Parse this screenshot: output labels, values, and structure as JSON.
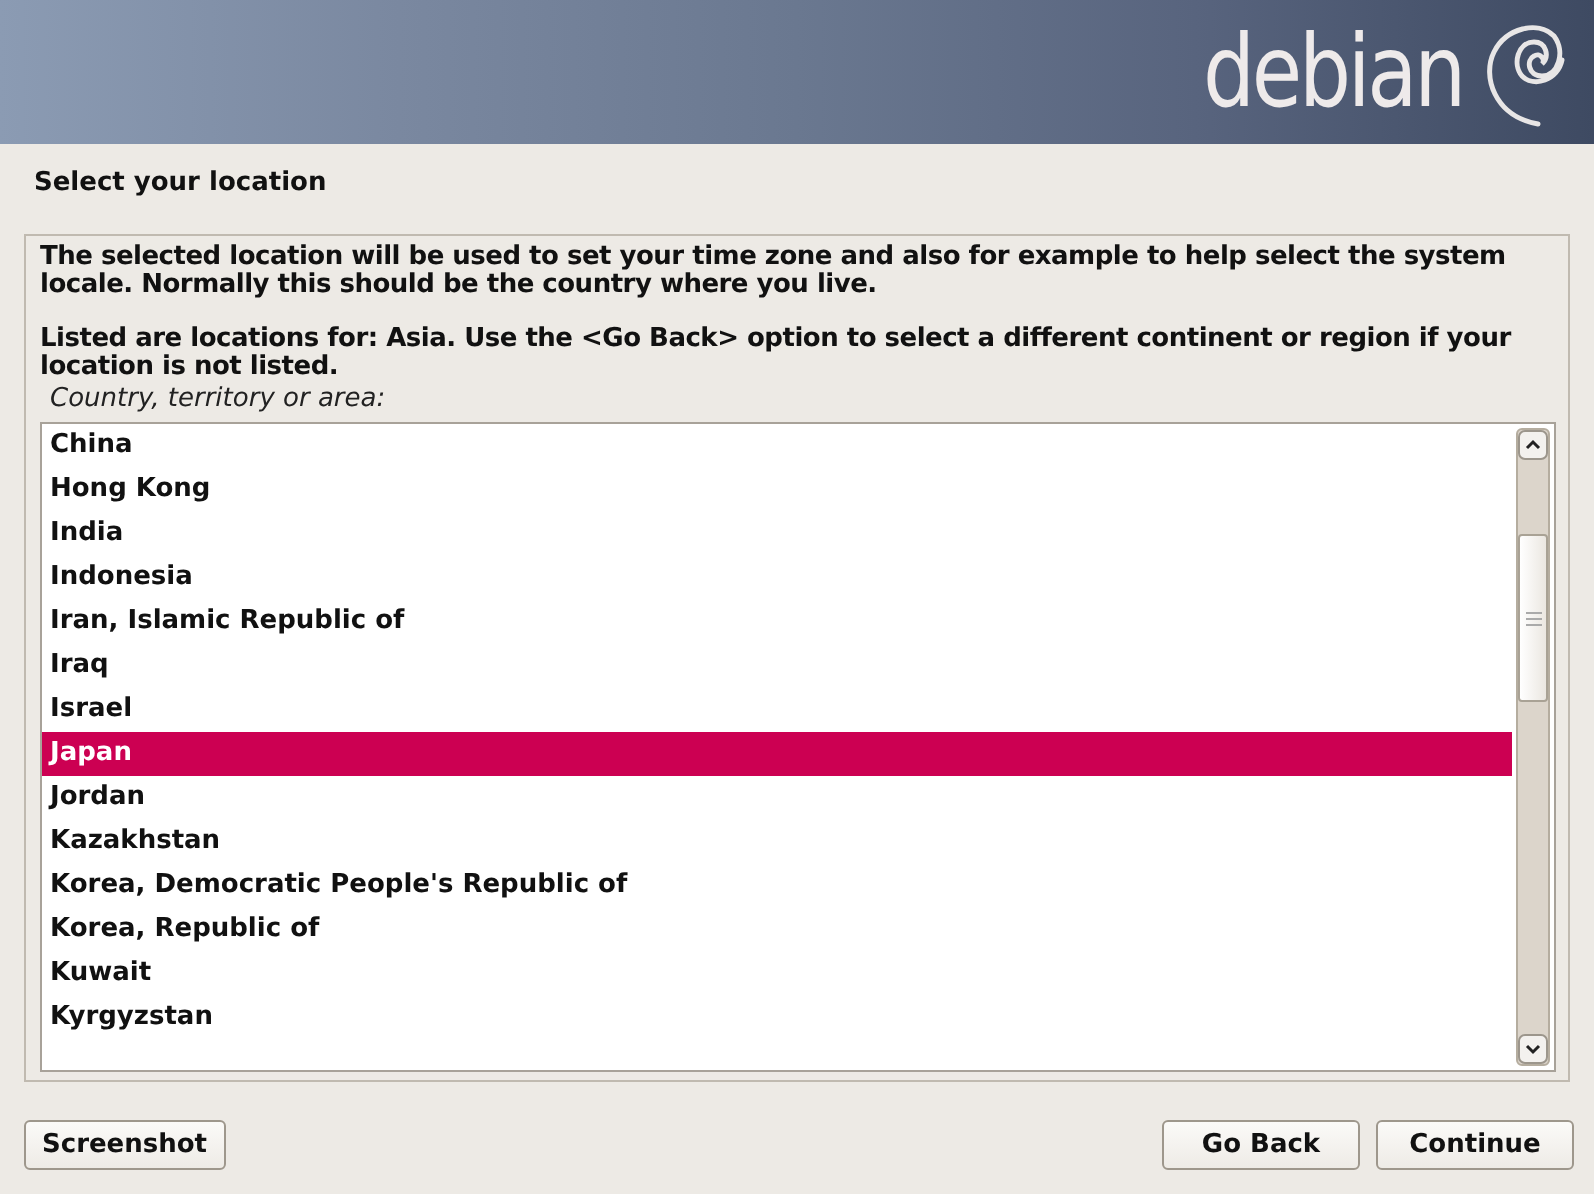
{
  "banner": {
    "logo_text": "debian"
  },
  "page_title": "Select your location",
  "paragraphs": [
    "The selected location will be used to set your time zone and also for example to help select the system locale. Normally this should be the country where you live.",
    "Listed are locations for: Asia. Use the <Go Back> option to select a different continent or region if your location is not listed."
  ],
  "list_label": "Country, territory or area:",
  "items": [
    {
      "label": "China",
      "selected": false
    },
    {
      "label": "Hong Kong",
      "selected": false
    },
    {
      "label": "India",
      "selected": false
    },
    {
      "label": "Indonesia",
      "selected": false
    },
    {
      "label": "Iran, Islamic Republic of",
      "selected": false
    },
    {
      "label": "Iraq",
      "selected": false
    },
    {
      "label": "Israel",
      "selected": false
    },
    {
      "label": "Japan",
      "selected": true
    },
    {
      "label": "Jordan",
      "selected": false
    },
    {
      "label": "Kazakhstan",
      "selected": false
    },
    {
      "label": "Korea, Democratic People's Republic of",
      "selected": false
    },
    {
      "label": "Korea, Republic of",
      "selected": false
    },
    {
      "label": "Kuwait",
      "selected": false
    },
    {
      "label": "Kyrgyzstan",
      "selected": false
    }
  ],
  "left_buttons": [
    "Screenshot"
  ],
  "right_buttons": [
    "Go Back",
    "Continue"
  ]
}
